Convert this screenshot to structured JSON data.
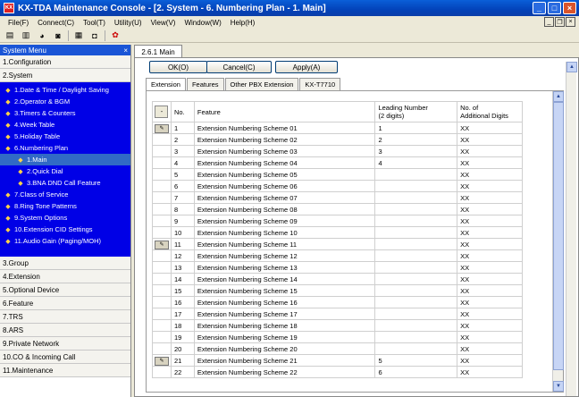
{
  "window": {
    "title": "KX-TDA Maintenance Console - [2. System - 6. Numbering Plan - 1. Main]",
    "app_icon": "KX",
    "minimize": "_",
    "maximize": "□",
    "close": "×"
  },
  "menu": [
    "File(F)",
    "Connect(C)",
    "Tool(T)",
    "Utility(U)",
    "View(V)",
    "Window(W)",
    "Help(H)"
  ],
  "sidebar": {
    "header": "System Menu",
    "close": "×",
    "sections_top": [
      "1.Configuration",
      "2.System"
    ],
    "items": [
      {
        "label": "1.Date & Time / Daylight Saving",
        "indent": 0,
        "icon": "clock-icon"
      },
      {
        "label": "2.Operator & BGM",
        "indent": 0,
        "icon": "operator-icon"
      },
      {
        "label": "3.Timers & Counters",
        "indent": 0,
        "icon": "timer-icon"
      },
      {
        "label": "4.Week Table",
        "indent": 0,
        "icon": "week-icon"
      },
      {
        "label": "5.Holiday Table",
        "indent": 0,
        "icon": "holiday-icon"
      },
      {
        "label": "6.Numbering Plan",
        "indent": 0,
        "icon": "numbering-icon"
      },
      {
        "label": "1.Main",
        "indent": 1,
        "icon": "main-icon",
        "selected": true
      },
      {
        "label": "2.Quick Dial",
        "indent": 1,
        "icon": "quick-dial-icon"
      },
      {
        "label": "3.BNA DND Call Feature",
        "indent": 1,
        "icon": "dnd-icon"
      },
      {
        "label": "7.Class of Service",
        "indent": 0,
        "icon": "cos-icon"
      },
      {
        "label": "8.Ring Tone Patterns",
        "indent": 0,
        "icon": "ring-icon"
      },
      {
        "label": "9.System Options",
        "indent": 0,
        "icon": "options-icon"
      },
      {
        "label": "10.Extension CID Settings",
        "indent": 0,
        "icon": "cid-icon"
      },
      {
        "label": "11.Audio Gain (Paging/MOH)",
        "indent": 0,
        "icon": "audio-icon"
      }
    ],
    "sections_bottom": [
      "3.Group",
      "4.Extension",
      "5.Optional Device",
      "6.Feature",
      "7.TRS",
      "8.ARS",
      "9.Private Network",
      "10.CO & Incoming Call",
      "11.Maintenance"
    ]
  },
  "doc_tab": "2.6.1 Main",
  "buttons": {
    "ok": "OK(O)",
    "cancel": "Cancel(C)",
    "apply": "Apply(A)"
  },
  "tabs": [
    "Extension",
    "Features",
    "Other PBX Extension",
    "KX-T7710"
  ],
  "table": {
    "headers": {
      "sel": "-",
      "no": "No.",
      "feature": "Feature",
      "leading": "Leading Number\n(2 digits)",
      "additional": "No. of\nAdditional Digits"
    },
    "rows": [
      {
        "sel": true,
        "no": "1",
        "feature": "Extension Numbering Scheme 01",
        "leading": "1",
        "additional": "XX"
      },
      {
        "sel": false,
        "no": "2",
        "feature": "Extension Numbering Scheme 02",
        "leading": "2",
        "additional": "XX"
      },
      {
        "sel": false,
        "no": "3",
        "feature": "Extension Numbering Scheme 03",
        "leading": "3",
        "additional": "XX"
      },
      {
        "sel": false,
        "no": "4",
        "feature": "Extension Numbering Scheme 04",
        "leading": "4",
        "additional": "XX"
      },
      {
        "sel": false,
        "no": "5",
        "feature": "Extension Numbering Scheme 05",
        "leading": "",
        "additional": "XX"
      },
      {
        "sel": false,
        "no": "6",
        "feature": "Extension Numbering Scheme 06",
        "leading": "",
        "additional": "XX"
      },
      {
        "sel": false,
        "no": "7",
        "feature": "Extension Numbering Scheme 07",
        "leading": "",
        "additional": "XX"
      },
      {
        "sel": false,
        "no": "8",
        "feature": "Extension Numbering Scheme 08",
        "leading": "",
        "additional": "XX"
      },
      {
        "sel": false,
        "no": "9",
        "feature": "Extension Numbering Scheme 09",
        "leading": "",
        "additional": "XX"
      },
      {
        "sel": false,
        "no": "10",
        "feature": "Extension Numbering Scheme 10",
        "leading": "",
        "additional": "XX"
      },
      {
        "sel": true,
        "no": "11",
        "feature": "Extension Numbering Scheme 11",
        "leading": "",
        "additional": "XX"
      },
      {
        "sel": false,
        "no": "12",
        "feature": "Extension Numbering Scheme 12",
        "leading": "",
        "additional": "XX"
      },
      {
        "sel": false,
        "no": "13",
        "feature": "Extension Numbering Scheme 13",
        "leading": "",
        "additional": "XX"
      },
      {
        "sel": false,
        "no": "14",
        "feature": "Extension Numbering Scheme 14",
        "leading": "",
        "additional": "XX"
      },
      {
        "sel": false,
        "no": "15",
        "feature": "Extension Numbering Scheme 15",
        "leading": "",
        "additional": "XX"
      },
      {
        "sel": false,
        "no": "16",
        "feature": "Extension Numbering Scheme 16",
        "leading": "",
        "additional": "XX"
      },
      {
        "sel": false,
        "no": "17",
        "feature": "Extension Numbering Scheme 17",
        "leading": "",
        "additional": "XX"
      },
      {
        "sel": false,
        "no": "18",
        "feature": "Extension Numbering Scheme 18",
        "leading": "",
        "additional": "XX"
      },
      {
        "sel": false,
        "no": "19",
        "feature": "Extension Numbering Scheme 19",
        "leading": "",
        "additional": "XX"
      },
      {
        "sel": false,
        "no": "20",
        "feature": "Extension Numbering Scheme 20",
        "leading": "",
        "additional": "XX"
      },
      {
        "sel": true,
        "no": "21",
        "feature": "Extension Numbering Scheme 21",
        "leading": "5",
        "additional": "XX"
      },
      {
        "sel": false,
        "no": "22",
        "feature": "Extension Numbering Scheme 22",
        "leading": "6",
        "additional": "XX"
      }
    ]
  }
}
